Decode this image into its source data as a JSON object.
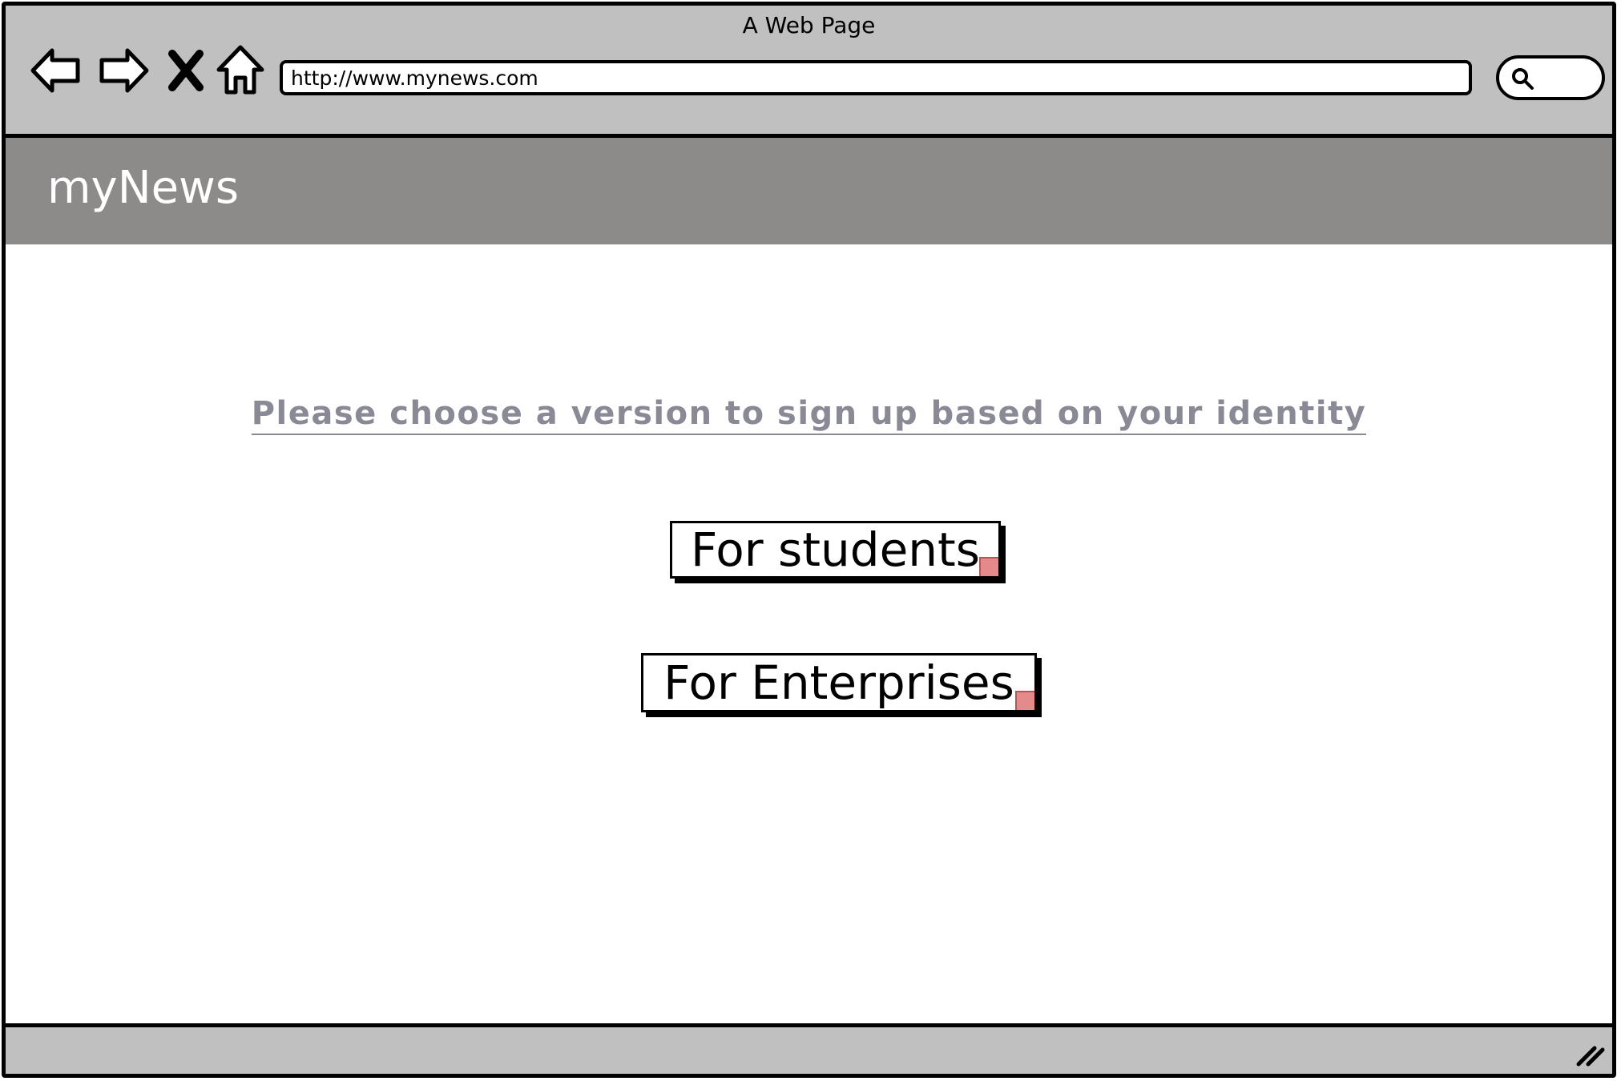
{
  "window": {
    "title": "A Web Page"
  },
  "toolbar": {
    "back_icon": "back-arrow-icon",
    "forward_icon": "forward-arrow-icon",
    "stop_icon": "close-icon",
    "home_icon": "home-icon",
    "url": "http://www.mynews.com",
    "search_icon": "search-icon"
  },
  "header": {
    "brand": "myNews"
  },
  "main": {
    "prompt": "Please choose a version to sign up based on your identity",
    "buttons": [
      {
        "label": "For students"
      },
      {
        "label": "For Enterprises"
      }
    ]
  },
  "colors": {
    "chrome": "#c0c0c0",
    "header_band": "#8c8b89",
    "prompt_text": "#8a8a96",
    "link_arrow": "#e58a8a"
  }
}
